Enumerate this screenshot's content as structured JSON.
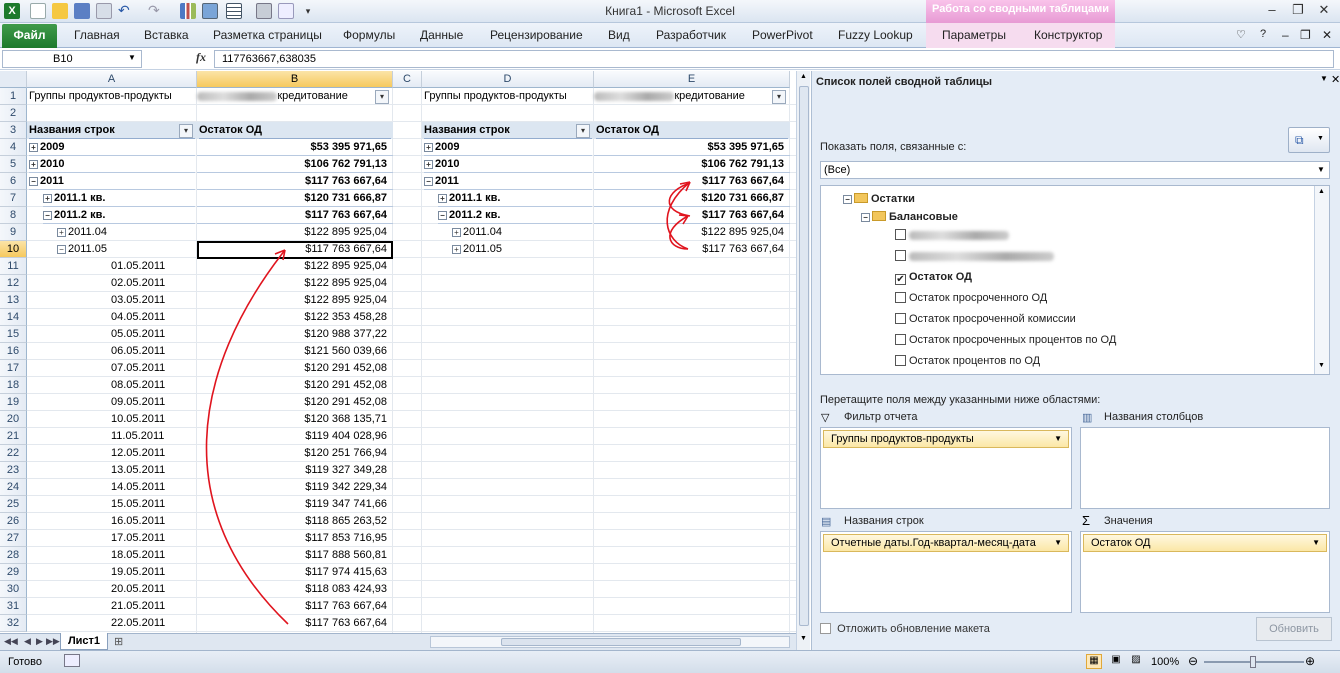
{
  "window": {
    "title": "Книга1  -  Microsoft Excel",
    "context_tab": "Работа со сводными таблицами"
  },
  "ribbon": {
    "file_tab": "Файл",
    "tabs": [
      "Главная",
      "Вставка",
      "Разметка страницы",
      "Формулы",
      "Данные",
      "Рецензирование",
      "Вид",
      "Разработчик",
      "PowerPivot",
      "Fuzzy Lookup"
    ],
    "context_tabs": [
      "Параметры",
      "Конструктор"
    ]
  },
  "formula_bar": {
    "name_box": "B10",
    "fx": "fx",
    "value": "117763667,638035"
  },
  "columns": [
    "A",
    "B",
    "C",
    "D",
    "E"
  ],
  "rows": [
    "1",
    "2",
    "3",
    "4",
    "5",
    "6",
    "7",
    "8",
    "9",
    "10",
    "11",
    "12",
    "13",
    "14",
    "15",
    "16",
    "17",
    "18",
    "19",
    "20",
    "21",
    "22",
    "23",
    "24",
    "25",
    "26",
    "27",
    "28",
    "29",
    "30",
    "31",
    "32"
  ],
  "pivot1": {
    "filter_label": "Группы продуктов-продукты",
    "filter_value_suffix": "кредитование",
    "row_header": "Названия строк",
    "value_header": "Остаток ОД",
    "items": [
      {
        "t": "+",
        "label": "2009",
        "value": "$53 395 971,65",
        "bold": true,
        "indent": 0
      },
      {
        "t": "+",
        "label": "2010",
        "value": "$106 762 791,13",
        "bold": true,
        "indent": 0
      },
      {
        "t": "−",
        "label": "2011",
        "value": "$117 763 667,64",
        "bold": true,
        "indent": 0
      },
      {
        "t": "+",
        "label": "2011.1 кв.",
        "value": "$120 731 666,87",
        "bold": true,
        "indent": 1
      },
      {
        "t": "−",
        "label": "2011.2 кв.",
        "value": "$117 763 667,64",
        "bold": true,
        "indent": 1
      },
      {
        "t": "+",
        "label": "2011.04",
        "value": "$122 895 925,04",
        "bold": false,
        "indent": 2
      },
      {
        "t": "−",
        "label": "2011.05",
        "value": "$117 763 667,64",
        "bold": false,
        "indent": 2
      },
      {
        "t": "",
        "label": "01.05.2011",
        "value": "$122 895 925,04",
        "bold": false,
        "indent": 3
      },
      {
        "t": "",
        "label": "02.05.2011",
        "value": "$122 895 925,04",
        "bold": false,
        "indent": 3
      },
      {
        "t": "",
        "label": "03.05.2011",
        "value": "$122 895 925,04",
        "bold": false,
        "indent": 3
      },
      {
        "t": "",
        "label": "04.05.2011",
        "value": "$122 353 458,28",
        "bold": false,
        "indent": 3
      },
      {
        "t": "",
        "label": "05.05.2011",
        "value": "$120 988 377,22",
        "bold": false,
        "indent": 3
      },
      {
        "t": "",
        "label": "06.05.2011",
        "value": "$121 560 039,66",
        "bold": false,
        "indent": 3
      },
      {
        "t": "",
        "label": "07.05.2011",
        "value": "$120 291 452,08",
        "bold": false,
        "indent": 3
      },
      {
        "t": "",
        "label": "08.05.2011",
        "value": "$120 291 452,08",
        "bold": false,
        "indent": 3
      },
      {
        "t": "",
        "label": "09.05.2011",
        "value": "$120 291 452,08",
        "bold": false,
        "indent": 3
      },
      {
        "t": "",
        "label": "10.05.2011",
        "value": "$120 368 135,71",
        "bold": false,
        "indent": 3
      },
      {
        "t": "",
        "label": "11.05.2011",
        "value": "$119 404 028,96",
        "bold": false,
        "indent": 3
      },
      {
        "t": "",
        "label": "12.05.2011",
        "value": "$120 251 766,94",
        "bold": false,
        "indent": 3
      },
      {
        "t": "",
        "label": "13.05.2011",
        "value": "$119 327 349,28",
        "bold": false,
        "indent": 3
      },
      {
        "t": "",
        "label": "14.05.2011",
        "value": "$119 342 229,34",
        "bold": false,
        "indent": 3
      },
      {
        "t": "",
        "label": "15.05.2011",
        "value": "$119 347 741,66",
        "bold": false,
        "indent": 3
      },
      {
        "t": "",
        "label": "16.05.2011",
        "value": "$118 865 263,52",
        "bold": false,
        "indent": 3
      },
      {
        "t": "",
        "label": "17.05.2011",
        "value": "$117 853 716,95",
        "bold": false,
        "indent": 3
      },
      {
        "t": "",
        "label": "18.05.2011",
        "value": "$117 888 560,81",
        "bold": false,
        "indent": 3
      },
      {
        "t": "",
        "label": "19.05.2011",
        "value": "$117 974 415,63",
        "bold": false,
        "indent": 3
      },
      {
        "t": "",
        "label": "20.05.2011",
        "value": "$118 083 424,93",
        "bold": false,
        "indent": 3
      },
      {
        "t": "",
        "label": "21.05.2011",
        "value": "$117 763 667,64",
        "bold": false,
        "indent": 3
      },
      {
        "t": "",
        "label": "22.05.2011",
        "value": "$117 763 667,64",
        "bold": false,
        "indent": 3
      }
    ]
  },
  "pivot2": {
    "filter_label": "Группы продуктов-продукты",
    "filter_value_suffix": "кредитование",
    "row_header": "Названия строк",
    "value_header": "Остаток ОД",
    "items": [
      {
        "t": "+",
        "label": "2009",
        "value": "$53 395 971,65",
        "bold": true,
        "indent": 0
      },
      {
        "t": "+",
        "label": "2010",
        "value": "$106 762 791,13",
        "bold": true,
        "indent": 0
      },
      {
        "t": "−",
        "label": "2011",
        "value": "$117 763 667,64",
        "bold": true,
        "indent": 0
      },
      {
        "t": "+",
        "label": "2011.1 кв.",
        "value": "$120 731 666,87",
        "bold": true,
        "indent": 1
      },
      {
        "t": "−",
        "label": "2011.2 кв.",
        "value": "$117 763 667,64",
        "bold": true,
        "indent": 1
      },
      {
        "t": "+",
        "label": "2011.04",
        "value": "$122 895 925,04",
        "bold": false,
        "indent": 2
      },
      {
        "t": "+",
        "label": "2011.05",
        "value": "$117 763 667,64",
        "bold": false,
        "indent": 2
      }
    ]
  },
  "sheet_tab": "Лист1",
  "panel": {
    "title": "Список полей сводной таблицы",
    "show_fields_label": "Показать поля, связанные с:",
    "show_fields_value": "(Все)",
    "tree": {
      "root": "Остатки",
      "group": "Балансовые",
      "fields": [
        {
          "label": "",
          "checked": false,
          "blurred": true
        },
        {
          "label": "",
          "checked": false,
          "blurred": true
        },
        {
          "label": "Остаток ОД",
          "checked": true,
          "blurred": false
        },
        {
          "label": "Остаток просроченного ОД",
          "checked": false,
          "blurred": false
        },
        {
          "label": "Остаток просроченной комиссии",
          "checked": false,
          "blurred": false
        },
        {
          "label": "Остаток просроченных процентов по ОД",
          "checked": false,
          "blurred": false
        },
        {
          "label": "Остаток процентов по ОД",
          "checked": false,
          "blurred": false
        }
      ]
    },
    "drag_hint": "Перетащите поля между указанными ниже областями:",
    "areas": {
      "filter": {
        "title": "Фильтр отчета",
        "item": "Группы продуктов-продукты"
      },
      "columns": {
        "title": "Названия столбцов",
        "item": ""
      },
      "rows": {
        "title": "Названия строк",
        "item": "Отчетные даты.Год-квартал-месяц-дата"
      },
      "values": {
        "title": "Значения",
        "item": "Остаток ОД"
      }
    },
    "defer_label": "Отложить обновление макета",
    "update_button": "Обновить"
  },
  "status": {
    "ready": "Готово",
    "zoom": "100%"
  },
  "colors": {
    "accent": "#1d7a2c",
    "context": "#e79ad4",
    "pivot_header": "#dce6f1",
    "annotation": "#e0141e"
  }
}
